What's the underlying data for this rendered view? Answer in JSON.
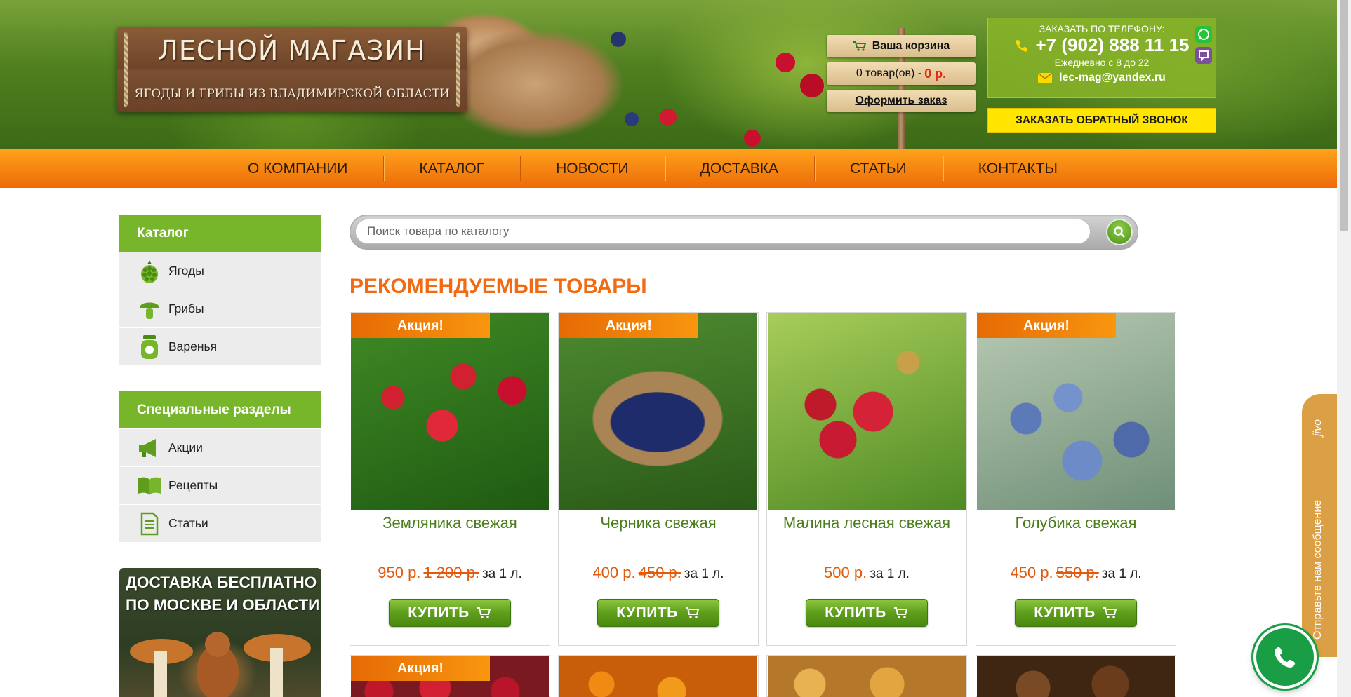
{
  "header": {
    "logo_title": "ЛЕСНОЙ МАГАЗИН",
    "logo_subtitle": "ЯГОДЫ И ГРИБЫ ИЗ ВЛАДИМИРСКОЙ ОБЛАСТИ",
    "cart": {
      "link": "Ваша корзина",
      "count_text": "0 товар(ов) -",
      "sum": "0 р.",
      "checkout": "Оформить заказ"
    },
    "contact": {
      "label": "ЗАКАЗАТЬ ПО ТЕЛЕФОНУ:",
      "phone": "+7 (902) 888 11 15",
      "hours": "Ежедневно с 8 до 22",
      "email": "lec-mag@yandex.ru"
    },
    "callback_button": "ЗАКАЗАТЬ ОБРАТНЫЙ ЗВОНОК"
  },
  "nav": {
    "items": [
      "О КОМПАНИИ",
      "КАТАЛОГ",
      "НОВОСТИ",
      "ДОСТАВКА",
      "СТАТЬИ",
      "КОНТАКТЫ"
    ]
  },
  "sidebar": {
    "catalog": {
      "title": "Каталог",
      "items": [
        {
          "label": "Ягоды",
          "icon": "berry-icon"
        },
        {
          "label": "Грибы",
          "icon": "mushroom-icon"
        },
        {
          "label": "Варенья",
          "icon": "jam-jar-icon"
        }
      ]
    },
    "special": {
      "title": "Специальные разделы",
      "items": [
        {
          "label": "Акции",
          "icon": "megaphone-icon"
        },
        {
          "label": "Рецепты",
          "icon": "book-icon"
        },
        {
          "label": "Статьи",
          "icon": "document-icon"
        }
      ]
    },
    "banner": {
      "line1": "ДОСТАВКА БЕСПЛАТНО",
      "line2": "ПО МОСКВЕ И ОБЛАСТИ"
    }
  },
  "search": {
    "placeholder": "Поиск товара по каталогу"
  },
  "main": {
    "section_title": "РЕКОМЕНДУЕМЫЕ ТОВАРЫ",
    "badge": "Акция!",
    "buy_label": "КУПИТЬ",
    "unit": "за 1 л.",
    "products": [
      {
        "name": "Земляника свежая",
        "price": "950 р.",
        "old_price": "1 200 р.",
        "promo": true
      },
      {
        "name": "Черника свежая",
        "price": "400 р.",
        "old_price": "450 р.",
        "promo": true
      },
      {
        "name": "Малина лесная свежая",
        "price": "500 р.",
        "old_price": "",
        "promo": false
      },
      {
        "name": "Голубика свежая",
        "price": "450 р.",
        "old_price": "550 р.",
        "promo": true
      }
    ],
    "second_row_badge": "Акция!"
  },
  "jivo": {
    "brand": "jivo",
    "message": "Отправьте нам сообщение"
  },
  "colors": {
    "accent_green": "#77b52b",
    "accent_orange": "#f26a11",
    "nav_orange": "#f58612",
    "callback_yellow": "#ffe500"
  }
}
